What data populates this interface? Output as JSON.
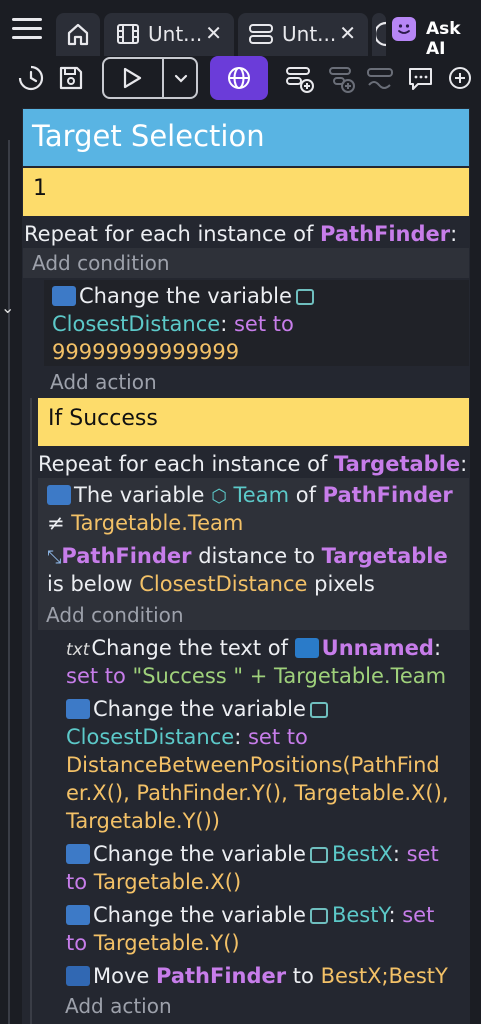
{
  "tabs": [
    {
      "icon": "home-icon"
    },
    {
      "icon": "film-icon",
      "label": "Unt...",
      "close": "✕"
    },
    {
      "icon": "events-icon",
      "label": "Unt...",
      "close": "✕"
    }
  ],
  "ask_ai": {
    "label": "Ask AI"
  },
  "toolbar_icons": [
    "history-icon",
    "save-icon",
    "play-icon",
    "chevron-down-icon",
    "globe-icon",
    "add-event-icon",
    "add-sub-event-icon",
    "add-condition-icon",
    "add-comment-icon",
    "add-icon"
  ],
  "colors": {
    "comment": "#59b4e3",
    "group": "#fddc6b",
    "accent": "#6b3cd9",
    "object": "#c77dea",
    "variable": "#5cc9c9",
    "value": "#f3c167"
  },
  "events": {
    "comment": "Target Selection",
    "group1": "1",
    "repeat1": {
      "prefix": "Repeat for each instance of ",
      "object": "PathFinder",
      "suffix": ":"
    },
    "add_condition_1": "Add condition",
    "action1": {
      "a": "Change the variable",
      "var": "ClosestDistance",
      "colon": ":",
      "set": "set to",
      "value": "99999999999999"
    },
    "add_action_1": "Add action",
    "group2": "If Success",
    "repeat2": {
      "prefix": "Repeat for each instance of ",
      "object": "Targetable",
      "suffix": ":"
    },
    "cond1": {
      "a": "The variable",
      "var": "Team",
      "of": " of ",
      "obj": "PathFinder",
      "neq": "≠ ",
      "value": "Targetable.Team"
    },
    "cond2": {
      "obj": "PathFinder",
      "a": " distance to ",
      "obj2": "Targetable",
      "b": "is below ",
      "value": "ClosestDistance",
      "c": " pixels"
    },
    "add_condition_2": "Add condition",
    "act_text": {
      "a": "Change the text of ",
      "obj": "Unnamed",
      "colon": ":",
      "set": "set to",
      "value": " \"Success \" + Targetable.Team"
    },
    "act_closest": {
      "a": "Change the variable",
      "var": "ClosestDistance",
      "colon": ":",
      "set": " set to",
      "l3": "DistanceBetweenPositions(PathFind",
      "l4": "er.X(), PathFinder.Y(), Targetable.X(),",
      "l5": "Targetable.Y())"
    },
    "act_bestx": {
      "a": "Change the variable",
      "var": "BestX",
      "colon": ":",
      "set": " set",
      "to": "to",
      "value": "Targetable.X()"
    },
    "act_besty": {
      "a": "Change the variable",
      "var": "BestY",
      "colon": ":",
      "set": " set",
      "to": "to",
      "value": "Targetable.Y()"
    },
    "act_move": {
      "a": "Move ",
      "obj": "PathFinder",
      "b": " to ",
      "value": "BestX;BestY"
    },
    "add_action_2": "Add action"
  }
}
